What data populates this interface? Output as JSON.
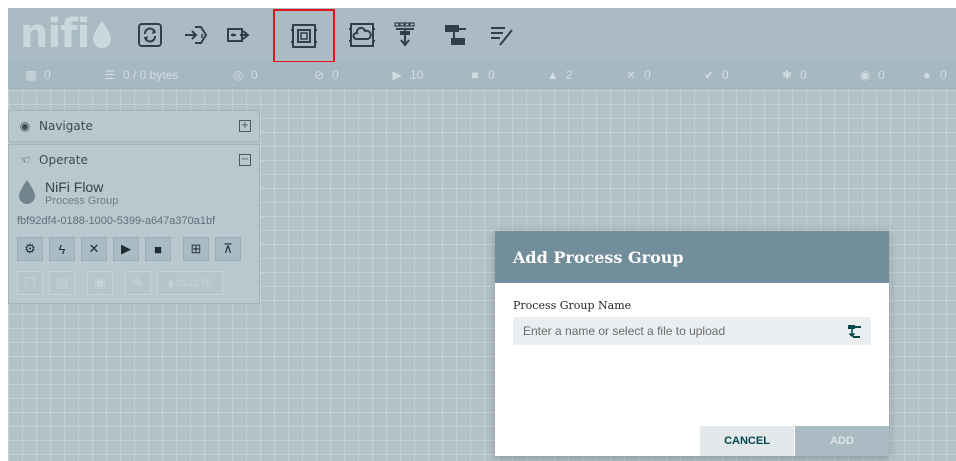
{
  "header": {
    "logo_text": "nifi",
    "tools": [
      {
        "name": "processor-icon"
      },
      {
        "name": "input-port-icon"
      },
      {
        "name": "output-port-icon"
      },
      {
        "name": "process-group-icon",
        "selected": true
      },
      {
        "name": "remote-process-group-icon"
      },
      {
        "name": "funnel-icon"
      },
      {
        "name": "template-icon"
      },
      {
        "name": "label-icon"
      }
    ]
  },
  "status": {
    "active_threads": "0",
    "queued": "0 / 0 bytes",
    "transmitting": "0",
    "not_transmitting": "0",
    "running": "10",
    "stopped": "0",
    "invalid": "2",
    "disabled": "0",
    "up_to_date": "0",
    "locally_modified": "0",
    "stale": "0",
    "sync_failure": "0"
  },
  "palette": {
    "navigate_label": "Navigate",
    "operate_label": "Operate",
    "flow_name": "NiFi Flow",
    "flow_type": "Process Group",
    "flow_id": "fbf92df4-0188-1000-5399-a647a370a1bf",
    "delete_label": "DELETE"
  },
  "dialog": {
    "title": "Add Process Group",
    "field_label": "Process Group Name",
    "field_placeholder": "Enter a name or select a file to upload",
    "cancel_label": "CANCEL",
    "add_label": "ADD"
  },
  "colors": {
    "header_bg": "#aabbc3",
    "dialog_header": "#728e9b",
    "selection_outline": "#e0161d",
    "cancel_text": "#004849"
  }
}
